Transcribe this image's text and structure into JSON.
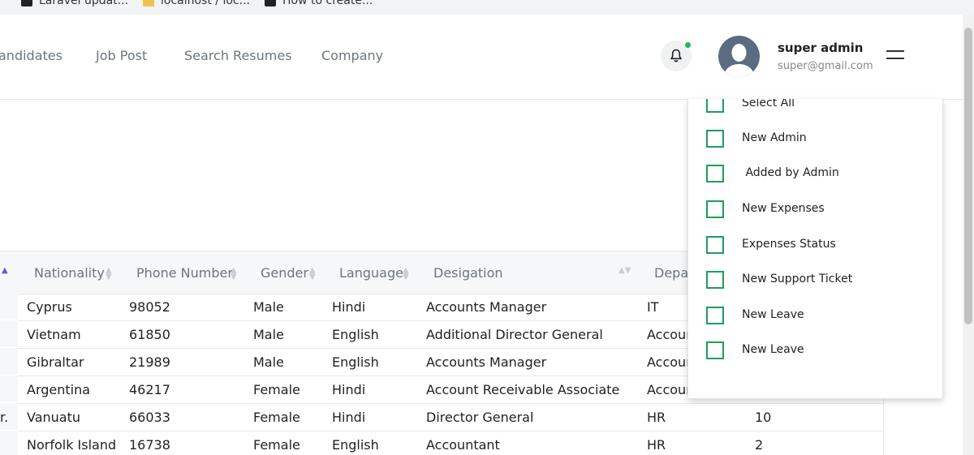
{
  "browser": {
    "bookmarks": [
      "Laravel updat...",
      "localhost / loc...",
      "How to create..."
    ]
  },
  "nav": {
    "links": [
      "andidates",
      "Job Post",
      "Search Resumes",
      "Company"
    ]
  },
  "header": {
    "bell_icon": "bell-icon",
    "notification_dot_color": "#1db954",
    "user_name": "super admin",
    "user_email": "super@gmail.com",
    "menu_icon": "hamburger-icon"
  },
  "table": {
    "columns": [
      "Nationality",
      "Phone Number",
      "Gender",
      "Language",
      "Desigation",
      "Depar"
    ],
    "rows": [
      {
        "prefix": "",
        "nationality": "Cyprus",
        "phone": "98052",
        "gender": "Male",
        "language": "Hindi",
        "designation": "Accounts Manager",
        "department": "IT",
        "count": ""
      },
      {
        "prefix": "",
        "nationality": "Vietnam",
        "phone": "61850",
        "gender": "Male",
        "language": "English",
        "designation": "Additional Director General",
        "department": "Accoun",
        "count": ""
      },
      {
        "prefix": "",
        "nationality": "Gibraltar",
        "phone": "21989",
        "gender": "Male",
        "language": "English",
        "designation": "Accounts Manager",
        "department": "Accoun",
        "count": ""
      },
      {
        "prefix": "",
        "nationality": "Argentina",
        "phone": "46217",
        "gender": "Female",
        "language": "Hindi",
        "designation": "Account Receivable Associate",
        "department": "Accoun",
        "count": ""
      },
      {
        "prefix": "r.",
        "nationality": "Vanuatu",
        "phone": "66033",
        "gender": "Female",
        "language": "Hindi",
        "designation": "Director General",
        "department": "HR",
        "count": "10"
      },
      {
        "prefix": "",
        "nationality": "Norfolk Island",
        "phone": "16738",
        "gender": "Female",
        "language": "English",
        "designation": "Accountant",
        "department": "HR",
        "count": "2"
      }
    ]
  },
  "notification_filter": {
    "options": [
      "Select All",
      "New Admin",
      " Added by Admin",
      "New Expenses",
      "Expenses Status",
      "New Support Ticket",
      "New Leave",
      "New Leave"
    ],
    "checkbox_color": "#1e9e5a"
  }
}
